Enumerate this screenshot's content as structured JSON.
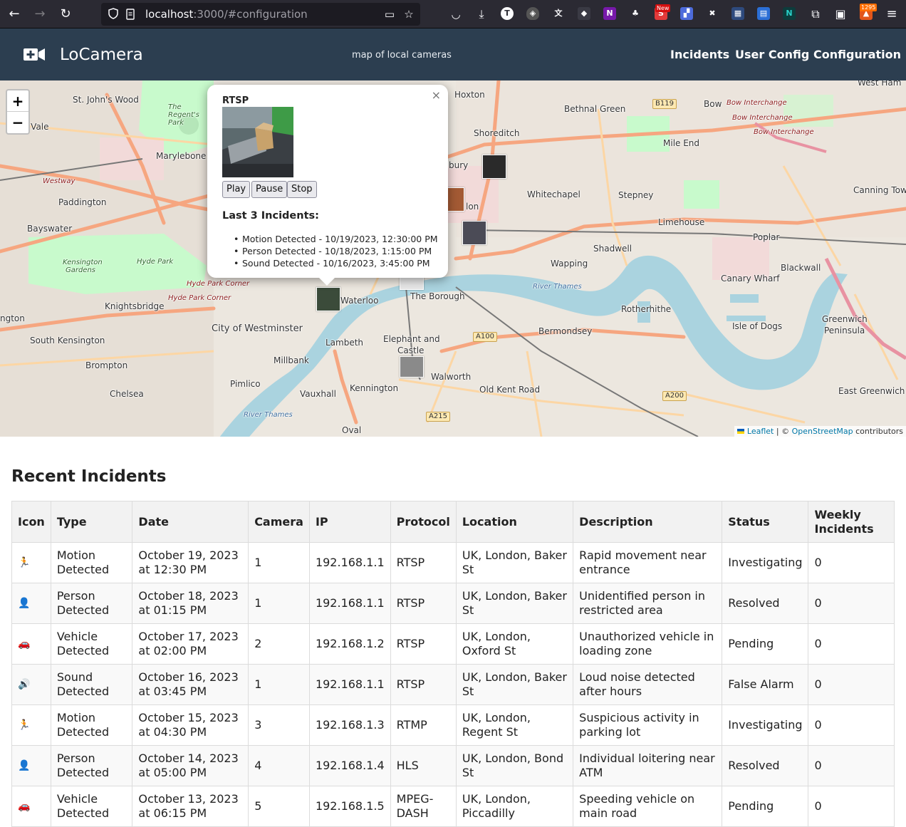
{
  "browser": {
    "url_host": "localhost",
    "url_rest": ":3000/#configuration",
    "badge_new": "New",
    "badge_count": "1295",
    "extension_letters": [
      "T",
      "N",
      "N"
    ]
  },
  "header": {
    "brand": "LoCamera",
    "tagline": "map of local cameras",
    "nav": [
      "Incidents",
      "User Config",
      "Configuration"
    ]
  },
  "map": {
    "zoom_in": "+",
    "zoom_out": "−",
    "labels": {
      "st_johns_wood": "St. John's Wood",
      "regents_park": "The Regent's Park",
      "maida_vale": "a Vale",
      "marylebone": "Marylebone",
      "westway": "Westway",
      "paddington": "Paddington",
      "bayswater": "Bayswater",
      "kensington_gardens": "Kensington Gardens",
      "hyde_park": "Hyde Park",
      "hyde_park_corner_1": "Hyde Park Corner",
      "hyde_park_corner_2": "Hyde Park Corner",
      "knightsbridge": "Knightsbridge",
      "ngton": "ngton",
      "south_kensington": "South Kensington",
      "city_of_westminster": "City of Westminster",
      "brompton": "Brompton",
      "chelsea": "Chelsea",
      "pimlico": "Pimlico",
      "millbank": "Millbank",
      "vauxhall": "Vauxhall",
      "lambeth": "Lambeth",
      "kennington": "Kennington",
      "oval": "Oval",
      "waterloo": "Waterloo",
      "the_borough": "The Borough",
      "elephant_castle_1": "Elephant and",
      "elephant_castle_2": "Castle",
      "walworth": "Walworth",
      "old_kent_road": "Old Kent Road",
      "bermondsey": "Bermondsey",
      "rotherhithe": "Rotherhithe",
      "wapping": "Wapping",
      "shadwell": "Shadwell",
      "limehouse": "Limehouse",
      "stepney": "Stepney",
      "whitechapel": "Whitechapel",
      "shoreditch": "Shoreditch",
      "hoxton": "Hoxton",
      "bethnal_green": "Bethnal Green",
      "bow": "Bow",
      "mile_end": "Mile End",
      "poplar": "Poplar",
      "canary_wharf": "Canary Wharf",
      "blackwall": "Blackwall",
      "isle_of_dogs": "Isle of Dogs",
      "greenwich_1": "Greenwich",
      "greenwich_2": "Peninsula",
      "east_greenwich": "East Greenwich",
      "canning_town": "Canning Tow",
      "west_ham": "West Ham",
      "bow_interchange_1": "Bow Interchange",
      "bow_interchange_2": "Bow Interchange",
      "bow_interchange_3": "Bow Interchange",
      "river_thames_1": "River Thames",
      "river_thames_2": "River Thames",
      "bury": "bury",
      "lon": "lon",
      "a100": "A100",
      "a200": "A200",
      "a215": "A215",
      "b119": "B119"
    },
    "attribution": {
      "leaflet": "Leaflet",
      "separator": " | © ",
      "osm": "OpenStreetMap",
      "suffix": " contributors"
    }
  },
  "popup": {
    "close": "×",
    "title": "RTSP",
    "buttons": [
      "Play",
      "Pause",
      "Stop"
    ],
    "subtitle": "Last 3 Incidents:",
    "incidents": [
      "Motion Detected - 10/19/2023, 12:30:00 PM",
      "Person Detected - 10/18/2023, 1:15:00 PM",
      "Sound Detected - 10/16/2023, 3:45:00 PM"
    ]
  },
  "incidents": {
    "title": "Recent Incidents",
    "columns": [
      "Icon",
      "Type",
      "Date",
      "Camera",
      "IP",
      "Protocol",
      "Location",
      "Description",
      "Status",
      "Weekly Incidents"
    ],
    "rows": [
      {
        "icon": "🏃",
        "type": "Motion Detected",
        "date": "October 19, 2023 at 12:30 PM",
        "camera": "1",
        "ip": "192.168.1.1",
        "protocol": "RTSP",
        "location": "UK, London, Baker St",
        "description": "Rapid movement near entrance",
        "status": "Investigating",
        "weekly": "0"
      },
      {
        "icon": "👤",
        "type": "Person Detected",
        "date": "October 18, 2023 at 01:15 PM",
        "camera": "1",
        "ip": "192.168.1.1",
        "protocol": "RTSP",
        "location": "UK, London, Baker St",
        "description": "Unidentified person in restricted area",
        "status": "Resolved",
        "weekly": "0"
      },
      {
        "icon": "🚗",
        "type": "Vehicle Detected",
        "date": "October 17, 2023 at 02:00 PM",
        "camera": "2",
        "ip": "192.168.1.2",
        "protocol": "RTSP",
        "location": "UK, London, Oxford St",
        "description": "Unauthorized vehicle in loading zone",
        "status": "Pending",
        "weekly": "0"
      },
      {
        "icon": "🔊",
        "type": "Sound Detected",
        "date": "October 16, 2023 at 03:45 PM",
        "camera": "1",
        "ip": "192.168.1.1",
        "protocol": "RTSP",
        "location": "UK, London, Baker St",
        "description": "Loud noise detected after hours",
        "status": "False Alarm",
        "weekly": "0"
      },
      {
        "icon": "🏃",
        "type": "Motion Detected",
        "date": "October 15, 2023 at 04:30 PM",
        "camera": "3",
        "ip": "192.168.1.3",
        "protocol": "RTMP",
        "location": "UK, London, Regent St",
        "description": "Suspicious activity in parking lot",
        "status": "Investigating",
        "weekly": "0"
      },
      {
        "icon": "👤",
        "type": "Person Detected",
        "date": "October 14, 2023 at 05:00 PM",
        "camera": "4",
        "ip": "192.168.1.4",
        "protocol": "HLS",
        "location": "UK, London, Bond St",
        "description": "Individual loitering near ATM",
        "status": "Resolved",
        "weekly": "0"
      },
      {
        "icon": "🚗",
        "type": "Vehicle Detected",
        "date": "October 13, 2023 at 06:15 PM",
        "camera": "5",
        "ip": "192.168.1.5",
        "protocol": "MPEG-DASH",
        "location": "UK, London, Piccadilly",
        "description": "Speeding vehicle on main road",
        "status": "Pending",
        "weekly": "0"
      }
    ]
  },
  "colors": {
    "header_bg": "#2c3e50",
    "browser_bg": "#2b2a33",
    "thames": "#aad3df",
    "park": "#c8facc",
    "road_primary": "#f6a680",
    "road_secondary": "#fcd6a4"
  }
}
